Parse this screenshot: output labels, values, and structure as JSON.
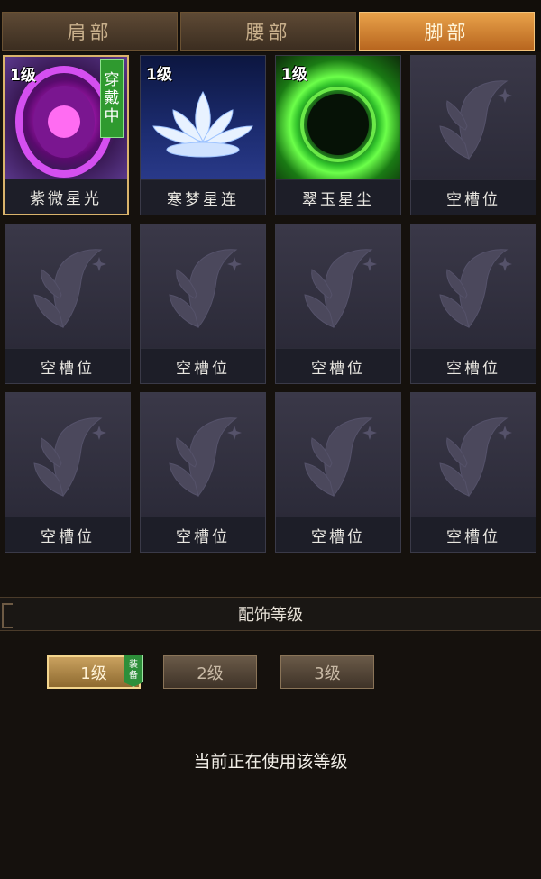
{
  "tabs": [
    {
      "label": "肩部",
      "active": false
    },
    {
      "label": "腰部",
      "active": false
    },
    {
      "label": "脚部",
      "active": true
    }
  ],
  "slots": [
    {
      "name": "紫微星光",
      "level": "1级",
      "wearing": "穿戴中",
      "icon": "purple-orb-icon"
    },
    {
      "name": "寒梦星连",
      "level": "1级",
      "icon": "lotus-icon"
    },
    {
      "name": "翠玉星尘",
      "level": "1级",
      "icon": "green-orb-icon"
    },
    {
      "name": "空槽位",
      "icon": "butterfly-icon"
    },
    {
      "name": "空槽位",
      "icon": "butterfly-icon"
    },
    {
      "name": "空槽位",
      "icon": "butterfly-icon"
    },
    {
      "name": "空槽位",
      "icon": "butterfly-icon"
    },
    {
      "name": "空槽位",
      "icon": "butterfly-icon"
    },
    {
      "name": "空槽位",
      "icon": "butterfly-icon"
    },
    {
      "name": "空槽位",
      "icon": "butterfly-icon"
    },
    {
      "name": "空槽位",
      "icon": "butterfly-icon"
    },
    {
      "name": "空槽位",
      "icon": "butterfly-icon"
    }
  ],
  "section": {
    "title": "配饰等级"
  },
  "levels": [
    {
      "label": "1级",
      "active": true,
      "tag": "装备"
    },
    {
      "label": "2级",
      "active": false
    },
    {
      "label": "3级",
      "active": false
    }
  ],
  "status": "当前正在使用该等级",
  "colors": {
    "accent": "#d9b36b",
    "tab_active": "#e9a24a",
    "equip_green": "#2f9a2f"
  }
}
